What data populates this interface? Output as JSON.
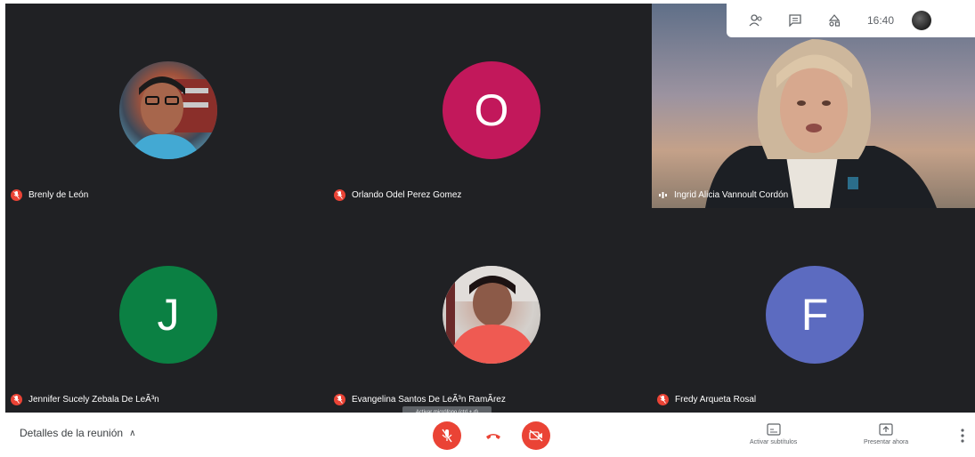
{
  "participants": [
    {
      "name": "Brenly de León",
      "kind": "photo",
      "muted": true,
      "photo_colors": [
        "#b5583f",
        "#2f3b4a",
        "#5aa3c0"
      ]
    },
    {
      "name": "Orlando Odel Perez Gomez",
      "kind": "letter",
      "letter": "O",
      "color": "#c2185b",
      "muted": true
    },
    {
      "name": "Ingrid Alicia Vannoult Cordón",
      "kind": "video",
      "muted": false,
      "speaking": true
    },
    {
      "name": "Jennifer Sucely Zebala De LeÃ³n",
      "kind": "letter",
      "letter": "J",
      "color": "#0b8043",
      "muted": true
    },
    {
      "name": "Evangelina Santos De LeÃ³n RamÃrez",
      "kind": "photo",
      "muted": true,
      "photo_colors": [
        "#a0322f",
        "#ea5a4f",
        "#2b1a1a"
      ]
    },
    {
      "name": "Fredy Arqueta Rosal",
      "kind": "letter",
      "letter": "F",
      "color": "#5c6bc0",
      "muted": true
    }
  ],
  "topbar": {
    "time": "16:40",
    "icons": [
      "people-icon",
      "chat-icon",
      "activities-icon"
    ]
  },
  "bottombar": {
    "details_label": "Detalles de la reunión",
    "tooltip": "Activar micrófono (ctrl + d)",
    "captions_label": "Activar subtítulos",
    "present_label": "Presentar ahora"
  },
  "colors": {
    "stage_bg": "#202124",
    "mute_red": "#ea4335",
    "text_white": "#ffffff"
  }
}
